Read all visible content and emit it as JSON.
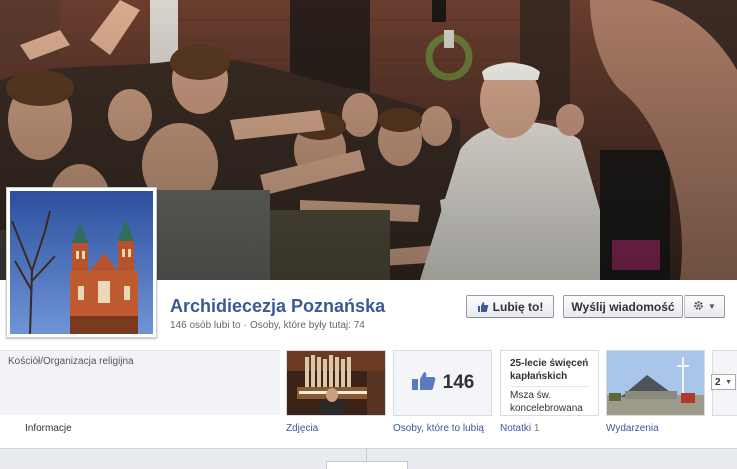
{
  "page": {
    "name": "Archidiecezja Poznańska",
    "likes_text": "146 osób lubi to",
    "separator": "·",
    "visited_text": "Osoby, które były tutaj: 74",
    "category": "Kościół/Organizacja religijna"
  },
  "actions": {
    "like_label": "Lubię to!",
    "message_label": "Wyślij wiadomość",
    "gear_arrow": "▼"
  },
  "tiles": {
    "likes_count": "146",
    "note_title": "25-lecie święceń kapłańskich",
    "note_body": "Msza św. koncelebrowana po",
    "more_value": "2",
    "more_arrow": "▼"
  },
  "tabs": {
    "info": "Informacje",
    "photos": "Zdjęcia",
    "likes": "Osoby, które to lubią",
    "notes": "Notatki",
    "notes_count": "1",
    "events": "Wydarzenia"
  },
  "colors": {
    "brand_blue": "#3b5998",
    "background": "#ffffff",
    "panel": "#f2f3f7"
  }
}
